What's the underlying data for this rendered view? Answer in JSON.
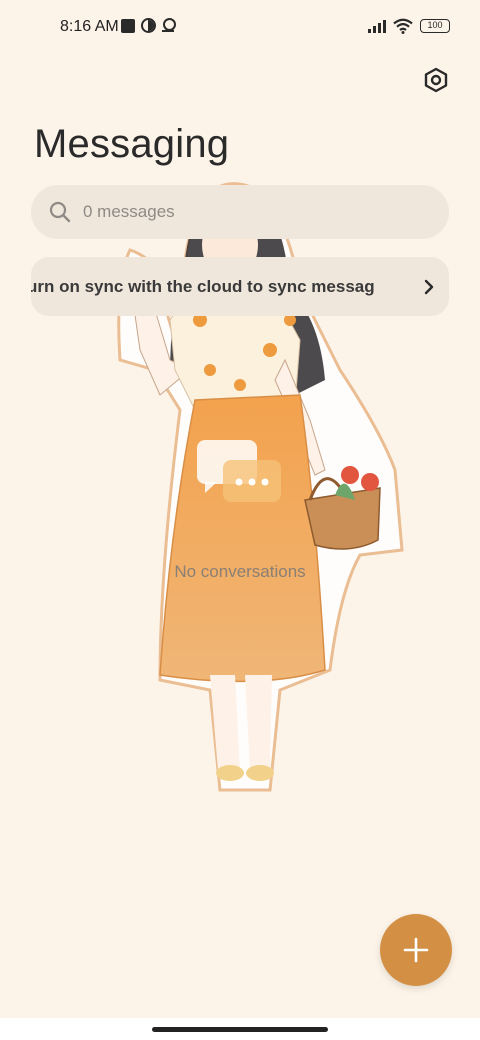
{
  "status_bar": {
    "time": "8:16 AM",
    "battery": "100",
    "icons": [
      "square-notification-icon",
      "half-circle-icon",
      "location-pin-icon",
      "signal-icon",
      "wifi-icon",
      "battery-icon"
    ]
  },
  "header": {
    "title": "Messaging",
    "settings_icon": "settings-hexagon-icon"
  },
  "search": {
    "placeholder": "0 messages"
  },
  "sync_banner": {
    "text": "urn on sync with the cloud to sync messag"
  },
  "empty_state": {
    "text": "No conversations",
    "icon": "chat-bubbles-icon"
  },
  "fab": {
    "icon": "plus-icon"
  },
  "colors": {
    "background": "#fdf4e9",
    "surface": "#efe6dc",
    "accent": "#d39044",
    "skirt": "#f0a558"
  }
}
